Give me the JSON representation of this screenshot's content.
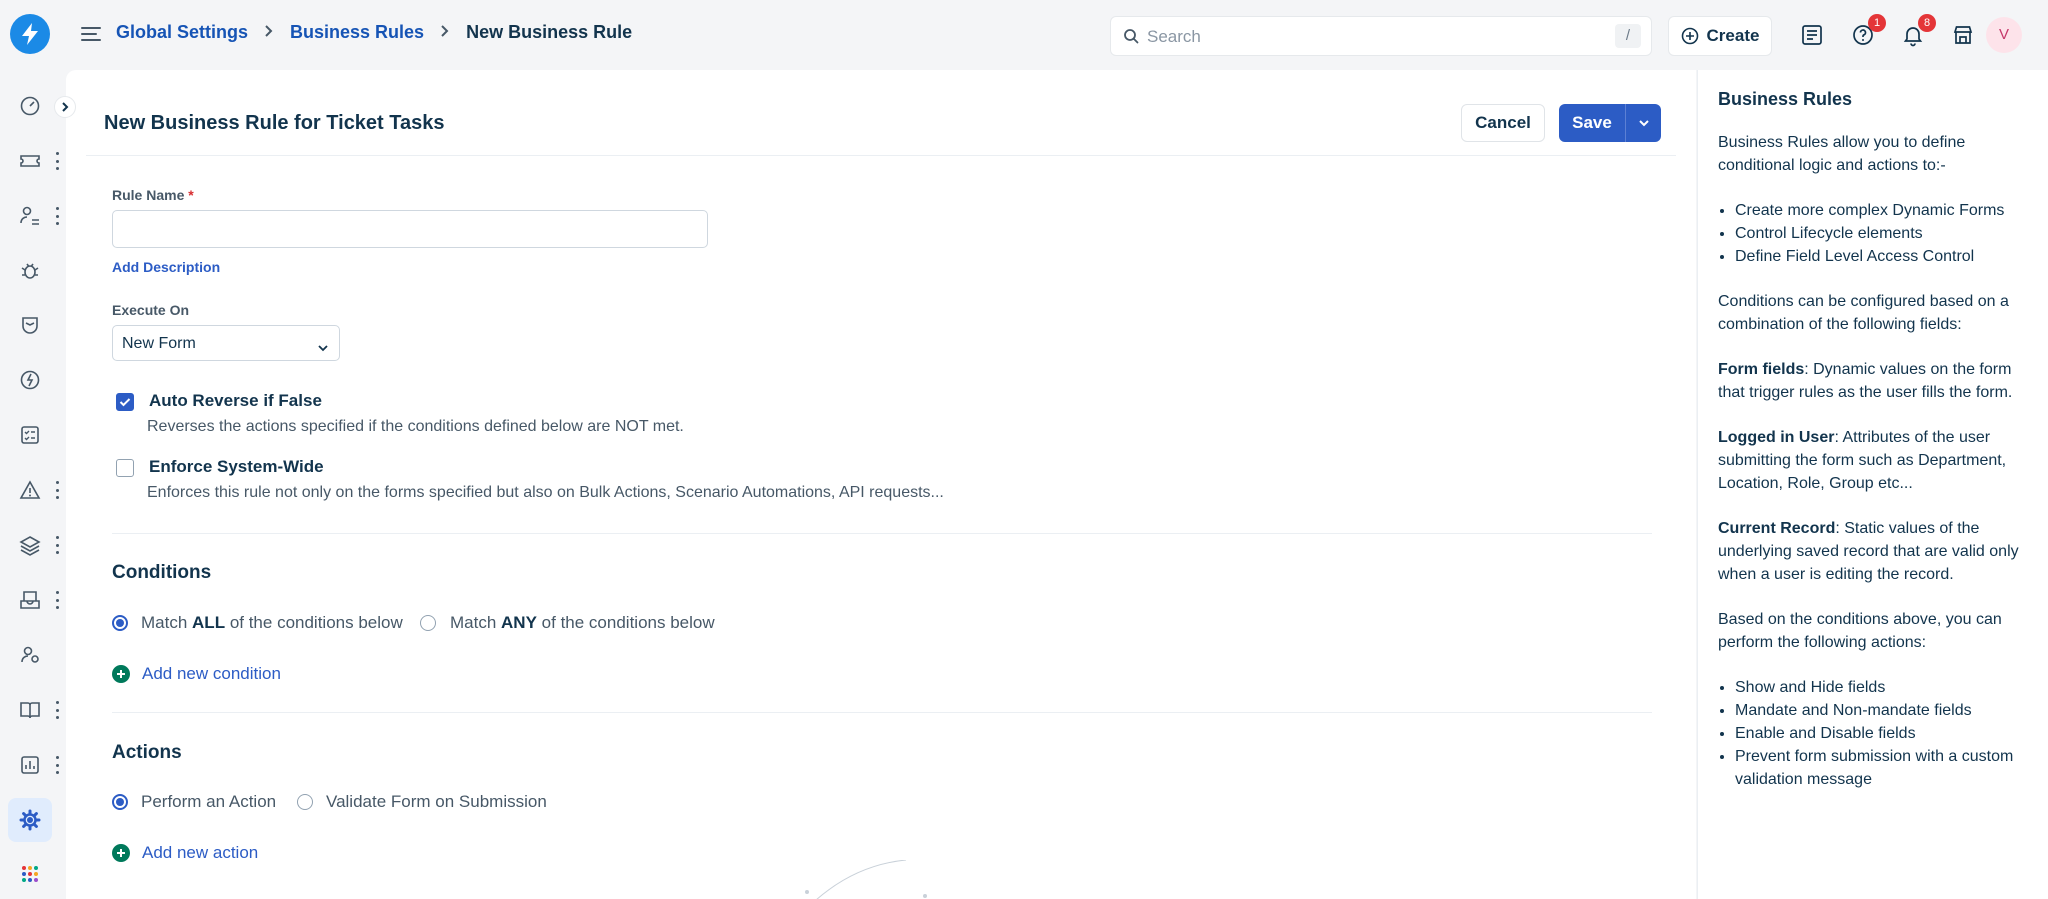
{
  "breadcrumb": {
    "item1": "Global Settings",
    "item2": "Business Rules",
    "current": "New Business Rule"
  },
  "search": {
    "placeholder": "Search",
    "shortcut": "/"
  },
  "header": {
    "create_label": "Create",
    "help_badge": "1",
    "notifications_badge": "8",
    "avatar_initial": "V"
  },
  "page": {
    "title": "New Business Rule for Ticket Tasks",
    "cancel_label": "Cancel",
    "save_label": "Save"
  },
  "form": {
    "rule_name_label": "Rule Name",
    "required_mark": "*",
    "rule_name_value": "",
    "add_description": "Add Description",
    "execute_on_label": "Execute On",
    "execute_on_value": "New Form",
    "auto_reverse_title": "Auto Reverse if False",
    "auto_reverse_desc": "Reverses the actions specified if the conditions defined below are NOT met.",
    "auto_reverse_checked": true,
    "enforce_title": "Enforce System-Wide",
    "enforce_desc": "Enforces this rule not only on the forms specified but also on Bulk Actions, Scenario Automations, API requests...",
    "enforce_checked": false
  },
  "conditions": {
    "title": "Conditions",
    "match_all_pre": "Match",
    "match_all_bold": "ALL",
    "match_all_post": "of the conditions below",
    "match_any_pre": "Match",
    "match_any_bold": "ANY",
    "match_any_post": "of the conditions below",
    "add_label": "Add new condition"
  },
  "actions": {
    "title": "Actions",
    "perform_label": "Perform an Action",
    "validate_label": "Validate Form on Submission",
    "add_label": "Add new action"
  },
  "help": {
    "title": "Business Rules",
    "intro": "Business Rules allow you to define conditional logic and actions to:-",
    "list1": [
      "Create more complex Dynamic Forms",
      "Control Lifecycle elements",
      "Define Field Level Access Control"
    ],
    "cond_intro": "Conditions can be configured based on a combination of the following fields:",
    "form_fields_bold": "Form fields",
    "form_fields_text": ": Dynamic values on the form that trigger rules as the user fills the form.",
    "logged_user_bold": "Logged in User",
    "logged_user_text": ": Attributes of the user submitting the form such as Department, Location, Role, Group etc...",
    "current_record_bold": "Current Record",
    "current_record_text": ": Static values of the underlying saved record that are valid only when a user is editing the record.",
    "actions_intro": "Based on the conditions above, you can perform the following actions:",
    "list2": [
      "Show and Hide fields",
      "Mandate and Non-mandate fields",
      "Enable and Disable fields",
      "Prevent form submission with a custom validation message"
    ]
  },
  "colors": {
    "brand": "#1b8ae6",
    "primary": "#2c5cc5",
    "link": "#1654b5",
    "add_icon": "#00795b",
    "badge": "#e43538"
  }
}
